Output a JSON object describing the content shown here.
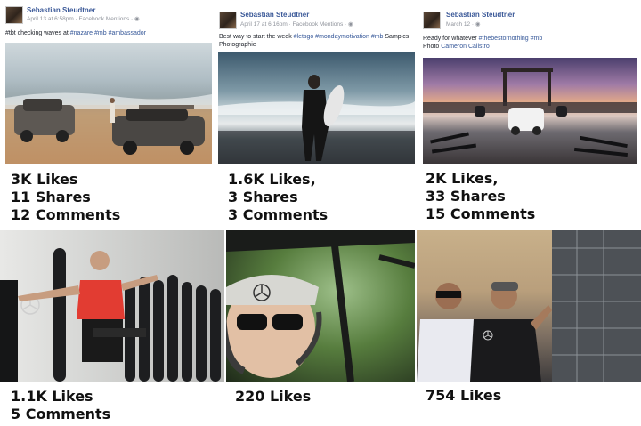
{
  "posts": [
    {
      "author": "Sebastian Steudtner",
      "meta": "April 13 at 6:58pm · Facebook Mentions · ◉",
      "caption_text": "#tbt checking waves at ",
      "caption_tags": "#nazare #mb #ambassador",
      "stats": [
        "3K Likes",
        "11 Shares",
        "12 Comments"
      ]
    },
    {
      "author": "Sebastian Steudtner",
      "meta": "April 17 at 6:16pm · Facebook Mentions · ◉",
      "caption_text": "Best way to start the week ",
      "caption_tags": "#letsgo #mondaymotivation #mb",
      "caption_tail": " Sampics",
      "caption_line2": "Photographie",
      "stats": [
        "1.6K  Likes,",
        "3 Shares",
        "3 Comments"
      ]
    },
    {
      "author": "Sebastian Steudtner",
      "meta": "March 12 · ◉",
      "caption_text": "Ready for whatever ",
      "caption_tags": "#thebestornothing #mb",
      "caption_line2_prefix": "Photo ",
      "caption_line2": "Cameron Calistro",
      "stats": [
        "2K Likes,",
        "33 Shares",
        "15 Comments"
      ]
    }
  ],
  "photo_posts": [
    {
      "stats": [
        "1.1K Likes",
        "5 Comments"
      ]
    },
    {
      "stats": [
        "220 Likes"
      ]
    },
    {
      "stats": [
        "754 Likes"
      ]
    }
  ],
  "colors": {
    "link": "#365899",
    "author": "#3b5998",
    "meta": "#90949c",
    "stat_text": "#111111"
  },
  "icons": [
    "globe-icon",
    "mercedes-logo-icon"
  ]
}
